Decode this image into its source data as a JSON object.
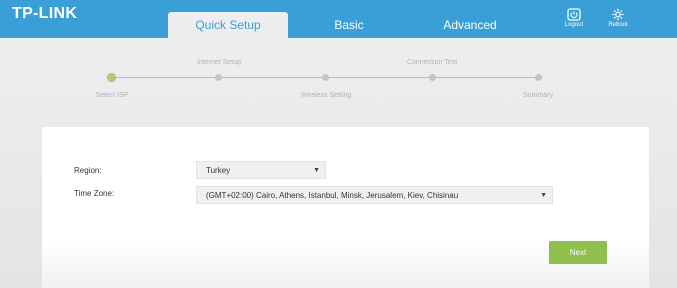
{
  "header": {
    "logo": "TP-LINK",
    "tabs": [
      {
        "label": "Quick Setup",
        "active": true
      },
      {
        "label": "Basic",
        "active": false
      },
      {
        "label": "Advanced",
        "active": false
      }
    ],
    "logout_label": "Logout",
    "reboot_label": "Reboot"
  },
  "progress": {
    "steps": [
      {
        "label": "Select ISP",
        "active": true
      },
      {
        "label": "Internet Setup",
        "active": false
      },
      {
        "label": "Wireless Setting",
        "active": false
      },
      {
        "label": "Connection Test",
        "active": false
      },
      {
        "label": "Summary",
        "active": false
      }
    ]
  },
  "form": {
    "region_label": "Region:",
    "region_value": "Turkey",
    "timezone_label": "Time Zone:",
    "timezone_value": "(GMT+02:00) Cairo, Athens, Istanbul, Minsk, Jerusalem, Kiev, Chisinau",
    "next_label": "Next"
  },
  "colors": {
    "header_blue": "#3a9fd6",
    "active_step": "#b6cc7a",
    "next_button": "#8fbf4c"
  }
}
